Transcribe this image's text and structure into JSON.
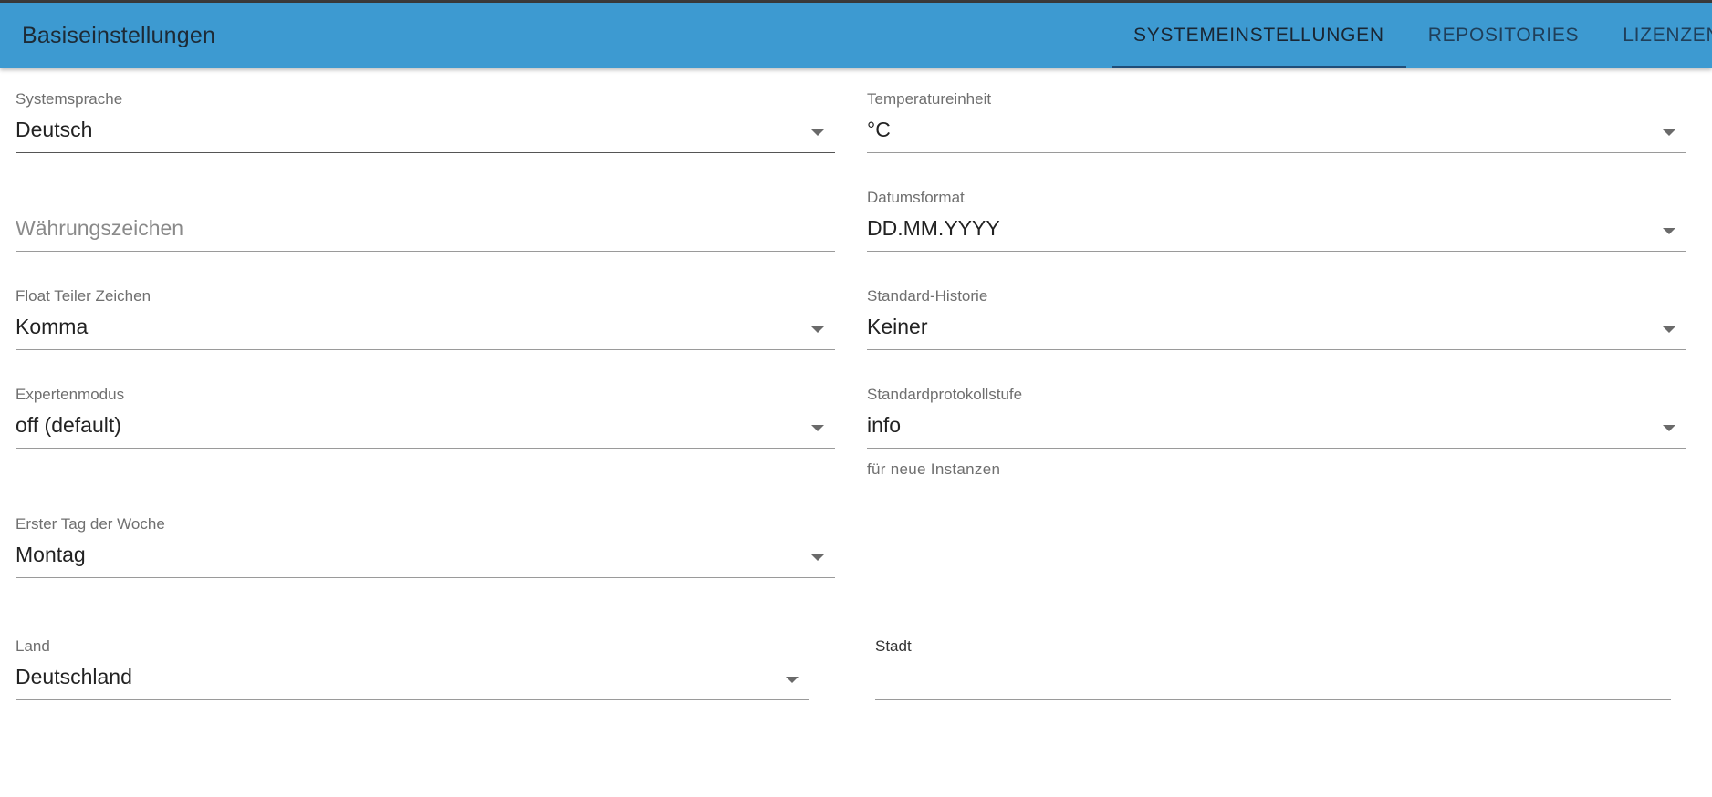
{
  "header": {
    "title": "Basiseinstellungen",
    "tabs": [
      {
        "label": "SYSTEMEINSTELLUNGEN"
      },
      {
        "label": "REPOSITORIES"
      },
      {
        "label": "LIZENZEN"
      }
    ]
  },
  "fields": {
    "systemsprache": {
      "label": "Systemsprache",
      "value": "Deutsch"
    },
    "temperatureinheit": {
      "label": "Temperatureinheit",
      "value": "°C"
    },
    "waehrungszeichen": {
      "placeholder": "Währungszeichen"
    },
    "datumsformat": {
      "label": "Datumsformat",
      "value": "DD.MM.YYYY"
    },
    "float_teiler": {
      "label": "Float Teiler Zeichen",
      "value": "Komma"
    },
    "standard_historie": {
      "label": "Standard-Historie",
      "value": "Keiner"
    },
    "expertenmodus": {
      "label": "Expertenmodus",
      "value": "off (default)"
    },
    "standardprotokollstufe": {
      "label": "Standardprotokollstufe",
      "value": "info",
      "helper": "für neue Instanzen"
    },
    "erster_tag": {
      "label": "Erster Tag der Woche",
      "value": "Montag"
    },
    "land": {
      "label": "Land",
      "value": "Deutschland"
    },
    "stadt": {
      "label": "Stadt",
      "value": ""
    }
  },
  "colors": {
    "appbar": "#3d9ad1",
    "tab_indicator": "#1f4e79"
  },
  "icons": {
    "dropdown": "chevron-down-icon"
  }
}
